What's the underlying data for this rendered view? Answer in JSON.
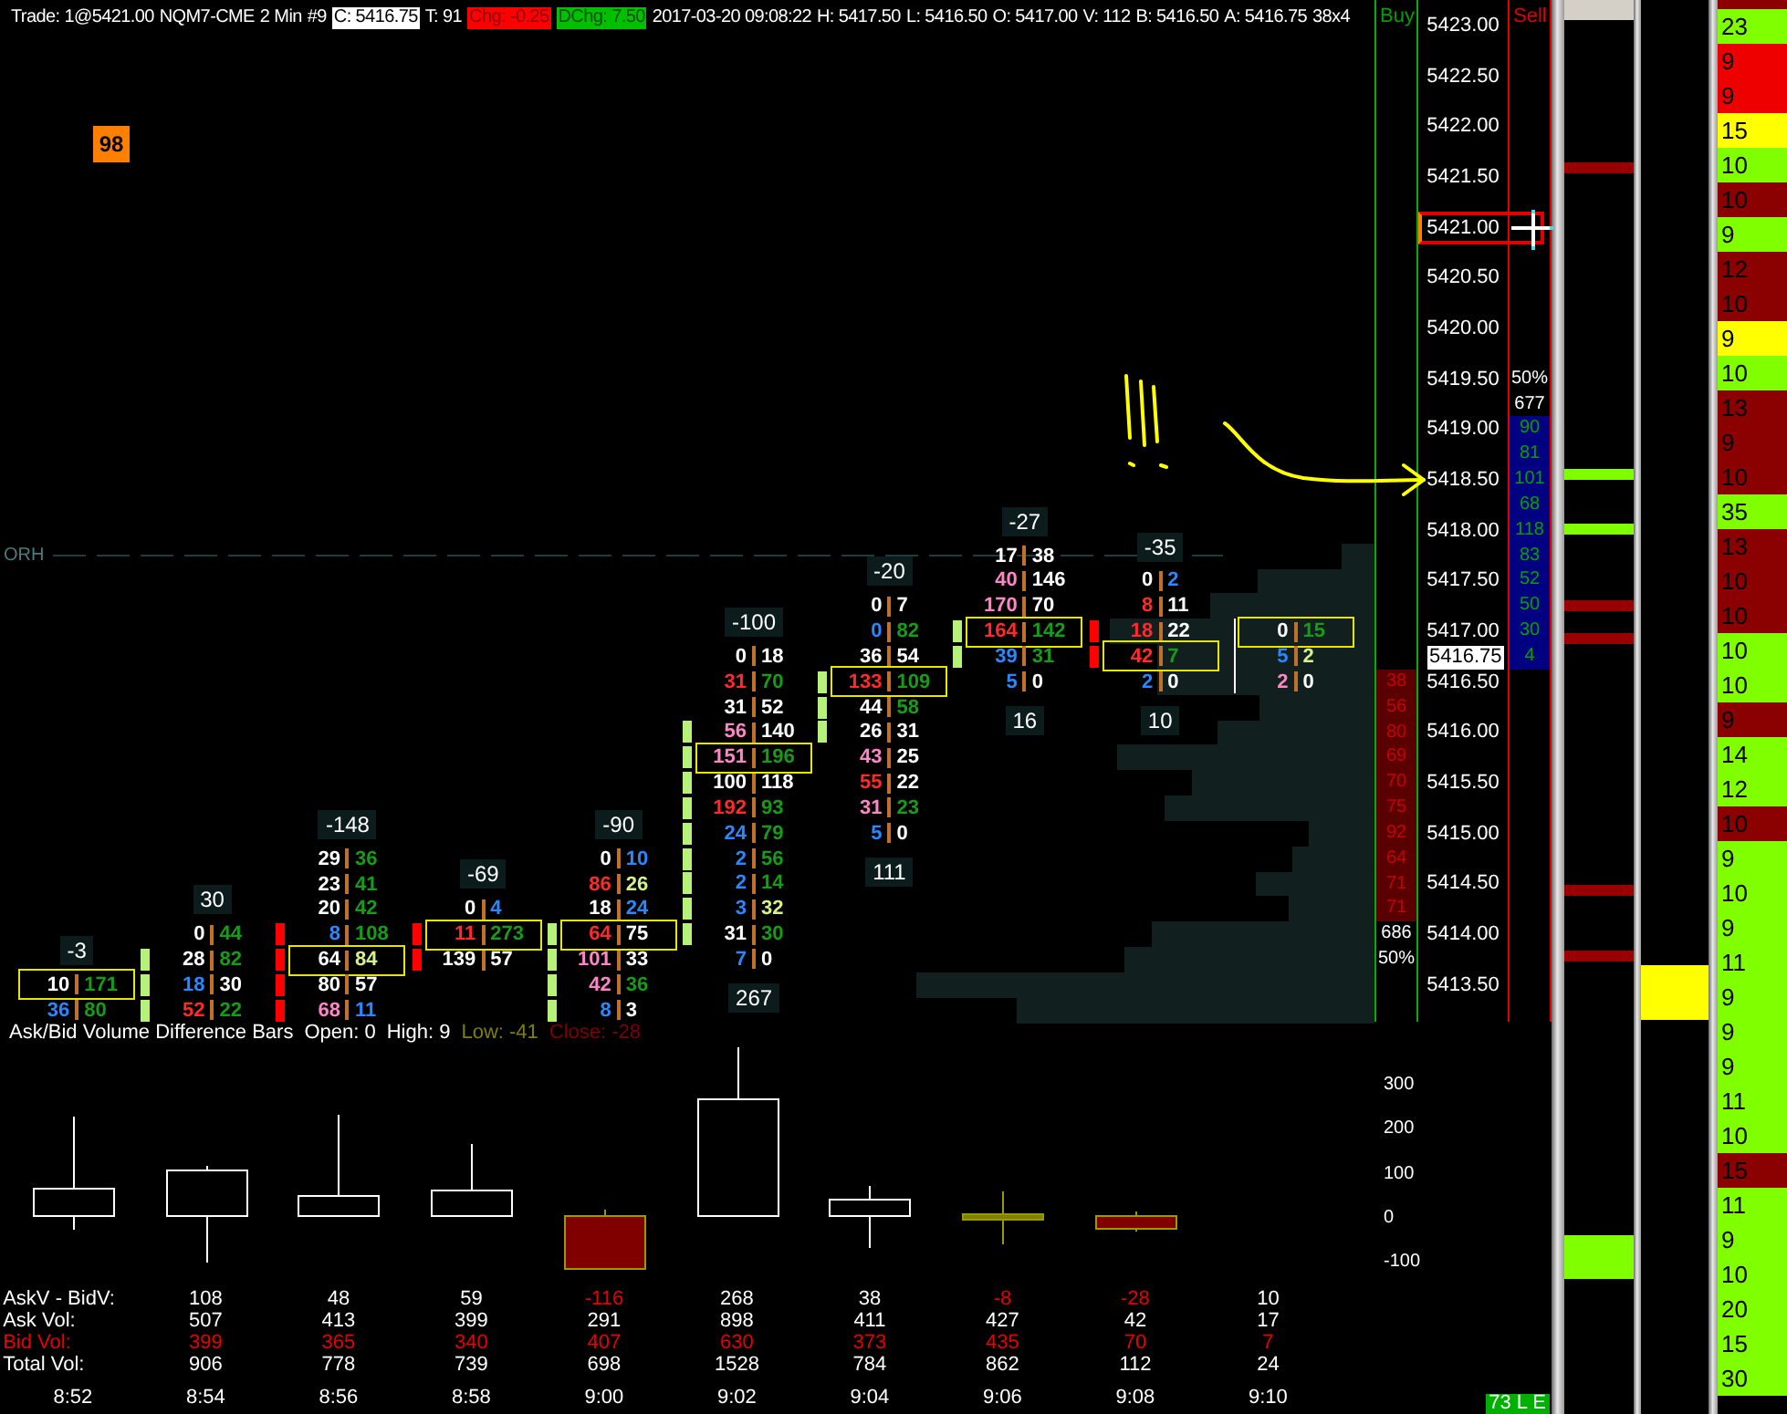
{
  "header": [
    {
      "text": "Trade: 1@5421.00",
      "kind": "plain"
    },
    {
      "text": "NQM7-CME",
      "kind": "plain"
    },
    {
      "text": "2 Min",
      "kind": "plain"
    },
    {
      "text": "#9",
      "kind": "plain"
    },
    {
      "text": "C: 5416.75",
      "kind": "close"
    },
    {
      "text": "T: 91",
      "kind": "plain"
    },
    {
      "text": "Chg: -0.25",
      "kind": "down"
    },
    {
      "text": "DChg: 7.50",
      "kind": "up"
    },
    {
      "text": "2017-03-20 09:08:22",
      "kind": "plain"
    },
    {
      "text": "H: 5417.50",
      "kind": "plain"
    },
    {
      "text": "L: 5416.50",
      "kind": "plain"
    },
    {
      "text": "O: 5417.00",
      "kind": "plain"
    },
    {
      "text": "V: 112",
      "kind": "plain"
    },
    {
      "text": "B: 5416.50",
      "kind": "plain"
    },
    {
      "text": "A: 5416.75",
      "kind": "plain"
    },
    {
      "text": "38x4",
      "kind": "plain"
    }
  ],
  "alert_badge": {
    "text": "98"
  },
  "reference_line": {
    "label": "ORH"
  },
  "footprint": {
    "columns": [
      {
        "delta": "-3",
        "rows": [
          {
            "bid": {
              "text": "10",
              "color": "#ffffff"
            },
            "ask": {
              "text": "171",
              "color": "#169c16"
            },
            "boxed": true
          },
          {
            "bid": {
              "text": "36",
              "color": "#2a88ff"
            },
            "ask": {
              "text": "80",
              "color": "#169c16"
            },
            "boxed": false
          }
        ]
      },
      {
        "delta": "30",
        "rows": [
          {
            "bid": {
              "text": "0",
              "color": "#ffffff"
            },
            "ask": {
              "text": "44",
              "color": "#169c16"
            },
            "boxed": false
          },
          {
            "bid": {
              "text": "28",
              "color": "#ffffff"
            },
            "ask": {
              "text": "82",
              "color": "#169c16"
            },
            "boxed": false,
            "marker": {
              "color": "#b6f27a"
            }
          },
          {
            "bid": {
              "text": "18",
              "color": "#2a88ff"
            },
            "ask": {
              "text": "30",
              "color": "#ffffff"
            },
            "boxed": false,
            "marker": {
              "color": "#b6f27a"
            }
          },
          {
            "bid": {
              "text": "52",
              "color": "#ff2a2a"
            },
            "ask": {
              "text": "22",
              "color": "#169c16"
            },
            "boxed": false,
            "marker": {
              "color": "#b6f27a"
            }
          }
        ]
      },
      {
        "delta": "-148",
        "rows": [
          {
            "bid": {
              "text": "29",
              "color": "#ffffff"
            },
            "ask": {
              "text": "36",
              "color": "#169c16"
            },
            "boxed": false
          },
          {
            "bid": {
              "text": "23",
              "color": "#ffffff"
            },
            "ask": {
              "text": "41",
              "color": "#169c16"
            },
            "boxed": false
          },
          {
            "bid": {
              "text": "20",
              "color": "#ffffff"
            },
            "ask": {
              "text": "42",
              "color": "#169c16"
            },
            "boxed": false
          },
          {
            "bid": {
              "text": "8",
              "color": "#2a88ff"
            },
            "ask": {
              "text": "108",
              "color": "#169c16"
            },
            "boxed": false,
            "marker": {
              "color": "#ff0000"
            }
          },
          {
            "bid": {
              "text": "64",
              "color": "#ffffff"
            },
            "ask": {
              "text": "84",
              "color": "#d6f08a"
            },
            "boxed": true,
            "marker": {
              "color": "#ff0000"
            }
          },
          {
            "bid": {
              "text": "80",
              "color": "#ffffff"
            },
            "ask": {
              "text": "57",
              "color": "#ffffff"
            },
            "boxed": false,
            "marker": {
              "color": "#ff0000"
            }
          },
          {
            "bid": {
              "text": "68",
              "color": "#ff86c6"
            },
            "ask": {
              "text": "11",
              "color": "#2a88ff"
            },
            "boxed": false,
            "marker": {
              "color": "#ff0000"
            }
          }
        ]
      },
      {
        "delta": "-69",
        "rows": [
          {
            "bid": {
              "text": "0",
              "color": "#ffffff"
            },
            "ask": {
              "text": "4",
              "color": "#2a88ff"
            },
            "boxed": false
          },
          {
            "bid": {
              "text": "11",
              "color": "#ff2a2a"
            },
            "ask": {
              "text": "273",
              "color": "#169c16"
            },
            "boxed": true,
            "marker": {
              "color": "#ff0000"
            }
          },
          {
            "bid": {
              "text": "139",
              "color": "#ffffff"
            },
            "ask": {
              "text": "57",
              "color": "#ffffff"
            },
            "boxed": false,
            "marker": {
              "color": "#ff0000"
            }
          }
        ]
      },
      {
        "delta": "-90",
        "rows": [
          {
            "bid": {
              "text": "0",
              "color": "#ffffff"
            },
            "ask": {
              "text": "10",
              "color": "#2a88ff"
            },
            "boxed": false
          },
          {
            "bid": {
              "text": "86",
              "color": "#ff2a2a"
            },
            "ask": {
              "text": "26",
              "color": "#d6f08a"
            },
            "boxed": false
          },
          {
            "bid": {
              "text": "18",
              "color": "#ffffff"
            },
            "ask": {
              "text": "24",
              "color": "#2a88ff"
            },
            "boxed": false
          },
          {
            "bid": {
              "text": "64",
              "color": "#ff2a2a"
            },
            "ask": {
              "text": "75",
              "color": "#ffffff"
            },
            "boxed": true,
            "marker": {
              "color": "#b6f27a"
            }
          },
          {
            "bid": {
              "text": "101",
              "color": "#ff86c6"
            },
            "ask": {
              "text": "33",
              "color": "#ffffff"
            },
            "boxed": false,
            "marker": {
              "color": "#b6f27a"
            }
          },
          {
            "bid": {
              "text": "42",
              "color": "#ff86c6"
            },
            "ask": {
              "text": "36",
              "color": "#169c16"
            },
            "boxed": false,
            "marker": {
              "color": "#b6f27a"
            }
          },
          {
            "bid": {
              "text": "8",
              "color": "#2a88ff"
            },
            "ask": {
              "text": "3",
              "color": "#ffffff"
            },
            "boxed": false,
            "marker": {
              "color": "#b6f27a"
            }
          }
        ]
      },
      {
        "delta": "-100",
        "total": "267",
        "rows": [
          {
            "bid": {
              "text": "0",
              "color": "#ffffff"
            },
            "ask": {
              "text": "18",
              "color": "#ffffff"
            },
            "boxed": false
          },
          {
            "bid": {
              "text": "31",
              "color": "#ff2a2a"
            },
            "ask": {
              "text": "70",
              "color": "#169c16"
            },
            "boxed": false
          },
          {
            "bid": {
              "text": "31",
              "color": "#ffffff"
            },
            "ask": {
              "text": "52",
              "color": "#ffffff"
            },
            "boxed": false
          },
          {
            "bid": {
              "text": "56",
              "color": "#ff86c6"
            },
            "ask": {
              "text": "140",
              "color": "#ffffff"
            },
            "boxed": false,
            "marker": {
              "color": "#b6f27a"
            }
          },
          {
            "bid": {
              "text": "151",
              "color": "#ff86c6"
            },
            "ask": {
              "text": "196",
              "color": "#169c16"
            },
            "boxed": true,
            "marker": {
              "color": "#b6f27a"
            }
          },
          {
            "bid": {
              "text": "100",
              "color": "#ffffff"
            },
            "ask": {
              "text": "118",
              "color": "#ffffff"
            },
            "boxed": false,
            "marker": {
              "color": "#b6f27a"
            }
          },
          {
            "bid": {
              "text": "192",
              "color": "#ff2a2a"
            },
            "ask": {
              "text": "93",
              "color": "#169c16"
            },
            "boxed": false,
            "marker": {
              "color": "#b6f27a"
            }
          },
          {
            "bid": {
              "text": "24",
              "color": "#2a88ff"
            },
            "ask": {
              "text": "79",
              "color": "#169c16"
            },
            "boxed": false,
            "marker": {
              "color": "#b6f27a"
            }
          },
          {
            "bid": {
              "text": "2",
              "color": "#2a88ff"
            },
            "ask": {
              "text": "56",
              "color": "#169c16"
            },
            "boxed": false,
            "marker": {
              "color": "#b6f27a"
            }
          },
          {
            "bid": {
              "text": "2",
              "color": "#2a88ff"
            },
            "ask": {
              "text": "14",
              "color": "#169c16"
            },
            "boxed": false,
            "marker": {
              "color": "#b6f27a"
            }
          },
          {
            "bid": {
              "text": "3",
              "color": "#2a88ff"
            },
            "ask": {
              "text": "32",
              "color": "#d6f08a"
            },
            "boxed": false,
            "marker": {
              "color": "#b6f27a"
            }
          },
          {
            "bid": {
              "text": "31",
              "color": "#ffffff"
            },
            "ask": {
              "text": "30",
              "color": "#169c16"
            },
            "boxed": false,
            "marker": {
              "color": "#b6f27a"
            }
          },
          {
            "bid": {
              "text": "7",
              "color": "#2a88ff"
            },
            "ask": {
              "text": "0",
              "color": "#ffffff"
            },
            "boxed": false
          }
        ]
      },
      {
        "delta": "-20",
        "total": "111",
        "rows": [
          {
            "bid": {
              "text": "0",
              "color": "#ffffff"
            },
            "ask": {
              "text": "7",
              "color": "#ffffff"
            },
            "boxed": false
          },
          {
            "bid": {
              "text": "0",
              "color": "#2a88ff"
            },
            "ask": {
              "text": "82",
              "color": "#169c16"
            },
            "boxed": false
          },
          {
            "bid": {
              "text": "36",
              "color": "#ffffff"
            },
            "ask": {
              "text": "54",
              "color": "#ffffff"
            },
            "boxed": false
          },
          {
            "bid": {
              "text": "133",
              "color": "#ff2a2a"
            },
            "ask": {
              "text": "109",
              "color": "#169c16"
            },
            "boxed": true,
            "marker": {
              "color": "#b6f27a"
            }
          },
          {
            "bid": {
              "text": "44",
              "color": "#ffffff"
            },
            "ask": {
              "text": "58",
              "color": "#169c16"
            },
            "boxed": false,
            "marker": {
              "color": "#b6f27a"
            }
          },
          {
            "bid": {
              "text": "26",
              "color": "#ffffff"
            },
            "ask": {
              "text": "31",
              "color": "#ffffff"
            },
            "boxed": false,
            "marker": {
              "color": "#b6f27a"
            }
          },
          {
            "bid": {
              "text": "43",
              "color": "#ff86c6"
            },
            "ask": {
              "text": "25",
              "color": "#ffffff"
            },
            "boxed": false
          },
          {
            "bid": {
              "text": "55",
              "color": "#ff2a2a"
            },
            "ask": {
              "text": "22",
              "color": "#ffffff"
            },
            "boxed": false
          },
          {
            "bid": {
              "text": "31",
              "color": "#ff86c6"
            },
            "ask": {
              "text": "23",
              "color": "#169c16"
            },
            "boxed": false
          },
          {
            "bid": {
              "text": "5",
              "color": "#2a88ff"
            },
            "ask": {
              "text": "0",
              "color": "#ffffff"
            },
            "boxed": false
          }
        ]
      },
      {
        "delta": "-27",
        "total": "16",
        "rows": [
          {
            "bid": {
              "text": "17",
              "color": "#ffffff"
            },
            "ask": {
              "text": "38",
              "color": "#ffffff"
            },
            "boxed": false
          },
          {
            "bid": {
              "text": "40",
              "color": "#ff86c6"
            },
            "ask": {
              "text": "146",
              "color": "#ffffff"
            },
            "boxed": false
          },
          {
            "bid": {
              "text": "170",
              "color": "#ff86c6"
            },
            "ask": {
              "text": "70",
              "color": "#ffffff"
            },
            "boxed": false
          },
          {
            "bid": {
              "text": "164",
              "color": "#ff2a2a"
            },
            "ask": {
              "text": "142",
              "color": "#169c16"
            },
            "boxed": true,
            "marker": {
              "color": "#b6f27a"
            }
          },
          {
            "bid": {
              "text": "39",
              "color": "#2a88ff"
            },
            "ask": {
              "text": "31",
              "color": "#169c16"
            },
            "boxed": false,
            "marker": {
              "color": "#b6f27a"
            }
          },
          {
            "bid": {
              "text": "5",
              "color": "#2a88ff"
            },
            "ask": {
              "text": "0",
              "color": "#ffffff"
            },
            "boxed": false
          }
        ]
      },
      {
        "delta": "-35",
        "total": "10",
        "rows": [
          {
            "bid": {
              "text": "0",
              "color": "#ffffff"
            },
            "ask": {
              "text": "2",
              "color": "#2a88ff"
            },
            "boxed": false
          },
          {
            "bid": {
              "text": "8",
              "color": "#ff2a2a"
            },
            "ask": {
              "text": "11",
              "color": "#ffffff"
            },
            "boxed": false
          },
          {
            "bid": {
              "text": "18",
              "color": "#ff2a2a"
            },
            "ask": {
              "text": "22",
              "color": "#ffffff"
            },
            "boxed": false,
            "marker": {
              "color": "#ff0000"
            }
          },
          {
            "bid": {
              "text": "42",
              "color": "#ff2a2a"
            },
            "ask": {
              "text": "7",
              "color": "#169c16"
            },
            "boxed": true,
            "marker": {
              "color": "#ff0000"
            }
          },
          {
            "bid": {
              "text": "2",
              "color": "#2a88ff"
            },
            "ask": {
              "text": "0",
              "color": "#ffffff"
            },
            "boxed": false
          }
        ]
      },
      {
        "rows": [
          {
            "bid": {
              "text": "0",
              "color": "#ffffff"
            },
            "ask": {
              "text": "15",
              "color": "#169c16"
            },
            "boxed": true
          },
          {
            "bid": {
              "text": "5",
              "color": "#2a88ff"
            },
            "ask": {
              "text": "2",
              "color": "#d6f08a"
            },
            "boxed": false
          },
          {
            "bid": {
              "text": "2",
              "color": "#ff86c6"
            },
            "ask": {
              "text": "0",
              "color": "#ffffff"
            },
            "boxed": false
          }
        ]
      }
    ]
  },
  "indicator": {
    "title": "Ask/Bid Volume Difference Bars",
    "values": [
      {
        "text": "Open: 0",
        "color": "#ffffff"
      },
      {
        "text": "High: 9",
        "color": "#ffffff"
      },
      {
        "text": "Low: -41",
        "color": "#808000"
      },
      {
        "text": "Close: -28",
        "color": "#800000"
      }
    ]
  },
  "periods": [
    {
      "time": "8:52",
      "candle": {
        "kind": "up"
      }
    },
    {
      "time": "8:54",
      "candle": {
        "kind": "up"
      }
    },
    {
      "time": "8:56",
      "candle": {
        "kind": "up"
      }
    },
    {
      "time": "8:58",
      "candle": {
        "kind": "up"
      }
    },
    {
      "time": "9:00",
      "candle": {
        "kind": "down"
      }
    },
    {
      "time": "9:02",
      "candle": {
        "kind": "up"
      }
    },
    {
      "time": "9:04",
      "candle": {
        "kind": "up"
      }
    },
    {
      "time": "9:06",
      "candle": {
        "kind": "flat"
      }
    },
    {
      "time": "9:08",
      "candle": {
        "kind": "down"
      }
    },
    {
      "time": "9:10"
    }
  ],
  "stats": [
    {
      "label": "AskV - BidV:",
      "kind": "delta",
      "values": [
        {
          "text": "108",
          "negative": false
        },
        {
          "text": "48",
          "negative": false
        },
        {
          "text": "59",
          "negative": false
        },
        {
          "text": "-116",
          "negative": true
        },
        {
          "text": "268",
          "negative": false
        },
        {
          "text": "38",
          "negative": false
        },
        {
          "text": "-8",
          "negative": true
        },
        {
          "text": "-28",
          "negative": true
        },
        {
          "text": "10",
          "negative": false
        }
      ]
    },
    {
      "label": "Ask Vol:",
      "kind": "ask",
      "values": [
        "507",
        "413",
        "399",
        "291",
        "898",
        "411",
        "427",
        "42",
        "17"
      ]
    },
    {
      "label": "Bid Vol:",
      "kind": "bid",
      "values": [
        "399",
        "365",
        "340",
        "407",
        "630",
        "373",
        "435",
        "70",
        "7"
      ]
    },
    {
      "label": "Total Vol:",
      "kind": "total",
      "values": [
        "906",
        "778",
        "739",
        "698",
        "1528",
        "784",
        "862",
        "112",
        "24"
      ]
    }
  ],
  "buy_side": {
    "label": "Buy",
    "levels": [
      "38",
      "56",
      "80",
      "69",
      "70",
      "75",
      "92",
      "64",
      "71",
      "71"
    ],
    "total": "686",
    "ratio": "50%"
  },
  "price_axis": {
    "labels": [
      {
        "text": "5423.00",
        "highlighted": false
      },
      {
        "text": "5422.50",
        "highlighted": false
      },
      {
        "text": "5422.00",
        "highlighted": false
      },
      {
        "text": "5421.50",
        "highlighted": false
      },
      {
        "text": "5421.00",
        "highlighted": true
      },
      {
        "text": "5420.50",
        "highlighted": false
      },
      {
        "text": "5420.00",
        "highlighted": false
      },
      {
        "text": "5419.50",
        "highlighted": false
      },
      {
        "text": "5419.00",
        "highlighted": false
      },
      {
        "text": "5418.50",
        "highlighted": false
      },
      {
        "text": "5418.00",
        "highlighted": false
      },
      {
        "text": "5417.50",
        "highlighted": false
      },
      {
        "text": "5417.00",
        "highlighted": false
      },
      {
        "text": "5416.50",
        "highlighted": false
      },
      {
        "text": "5416.00",
        "highlighted": false
      },
      {
        "text": "5415.50",
        "highlighted": false
      },
      {
        "text": "5415.00",
        "highlighted": false
      },
      {
        "text": "5414.50",
        "highlighted": false
      },
      {
        "text": "5414.00",
        "highlighted": false
      },
      {
        "text": "5413.50",
        "highlighted": false
      }
    ],
    "current_price": "5416.75"
  },
  "sell_side": {
    "label": "Sell",
    "ratio": "50%",
    "total": "677",
    "levels": [
      "90",
      "81",
      "101",
      "68",
      "118",
      "83",
      "52",
      "50",
      "30",
      "4"
    ]
  },
  "candle_axis": [
    "300",
    "200",
    "100",
    "0",
    "-100"
  ],
  "status_badge": {
    "text": "73 L E"
  },
  "tape": [
    {
      "color": "#8b0000"
    },
    {
      "text": "23",
      "color": "#80ff00"
    },
    {
      "text": "9",
      "color": "#ee0000"
    },
    {
      "text": "9",
      "color": "#ee0000"
    },
    {
      "text": "15",
      "color": "#ffff00"
    },
    {
      "text": "10",
      "color": "#80ff00"
    },
    {
      "text": "10",
      "color": "#8b0000"
    },
    {
      "text": "9",
      "color": "#80ff00"
    },
    {
      "text": "12",
      "color": "#8b0000"
    },
    {
      "text": "10",
      "color": "#8b0000"
    },
    {
      "text": "9",
      "color": "#ffff00"
    },
    {
      "text": "10",
      "color": "#80ff00"
    },
    {
      "text": "13",
      "color": "#8b0000"
    },
    {
      "text": "9",
      "color": "#8b0000"
    },
    {
      "text": "10",
      "color": "#8b0000"
    },
    {
      "text": "35",
      "color": "#80ff00"
    },
    {
      "text": "13",
      "color": "#8b0000"
    },
    {
      "text": "10",
      "color": "#8b0000"
    },
    {
      "text": "10",
      "color": "#8b0000"
    },
    {
      "text": "10",
      "color": "#80ff00"
    },
    {
      "text": "10",
      "color": "#80ff00"
    },
    {
      "text": "9",
      "color": "#8b0000"
    },
    {
      "text": "14",
      "color": "#80ff00"
    },
    {
      "text": "12",
      "color": "#80ff00"
    },
    {
      "text": "10",
      "color": "#8b0000"
    },
    {
      "text": "9",
      "color": "#80ff00"
    },
    {
      "text": "10",
      "color": "#80ff00"
    },
    {
      "text": "9",
      "color": "#80ff00"
    },
    {
      "text": "11",
      "color": "#80ff00"
    },
    {
      "text": "9",
      "color": "#80ff00"
    },
    {
      "text": "9",
      "color": "#80ff00"
    },
    {
      "text": "9",
      "color": "#80ff00"
    },
    {
      "text": "11",
      "color": "#80ff00"
    },
    {
      "text": "10",
      "color": "#80ff00"
    },
    {
      "text": "15",
      "color": "#8b0000"
    },
    {
      "text": "11",
      "color": "#80ff00"
    },
    {
      "text": "9",
      "color": "#80ff00"
    },
    {
      "text": "10",
      "color": "#80ff00"
    },
    {
      "text": "20",
      "color": "#80ff00"
    },
    {
      "text": "15",
      "color": "#80ff00"
    },
    {
      "text": "30",
      "color": "#80ff00"
    }
  ]
}
